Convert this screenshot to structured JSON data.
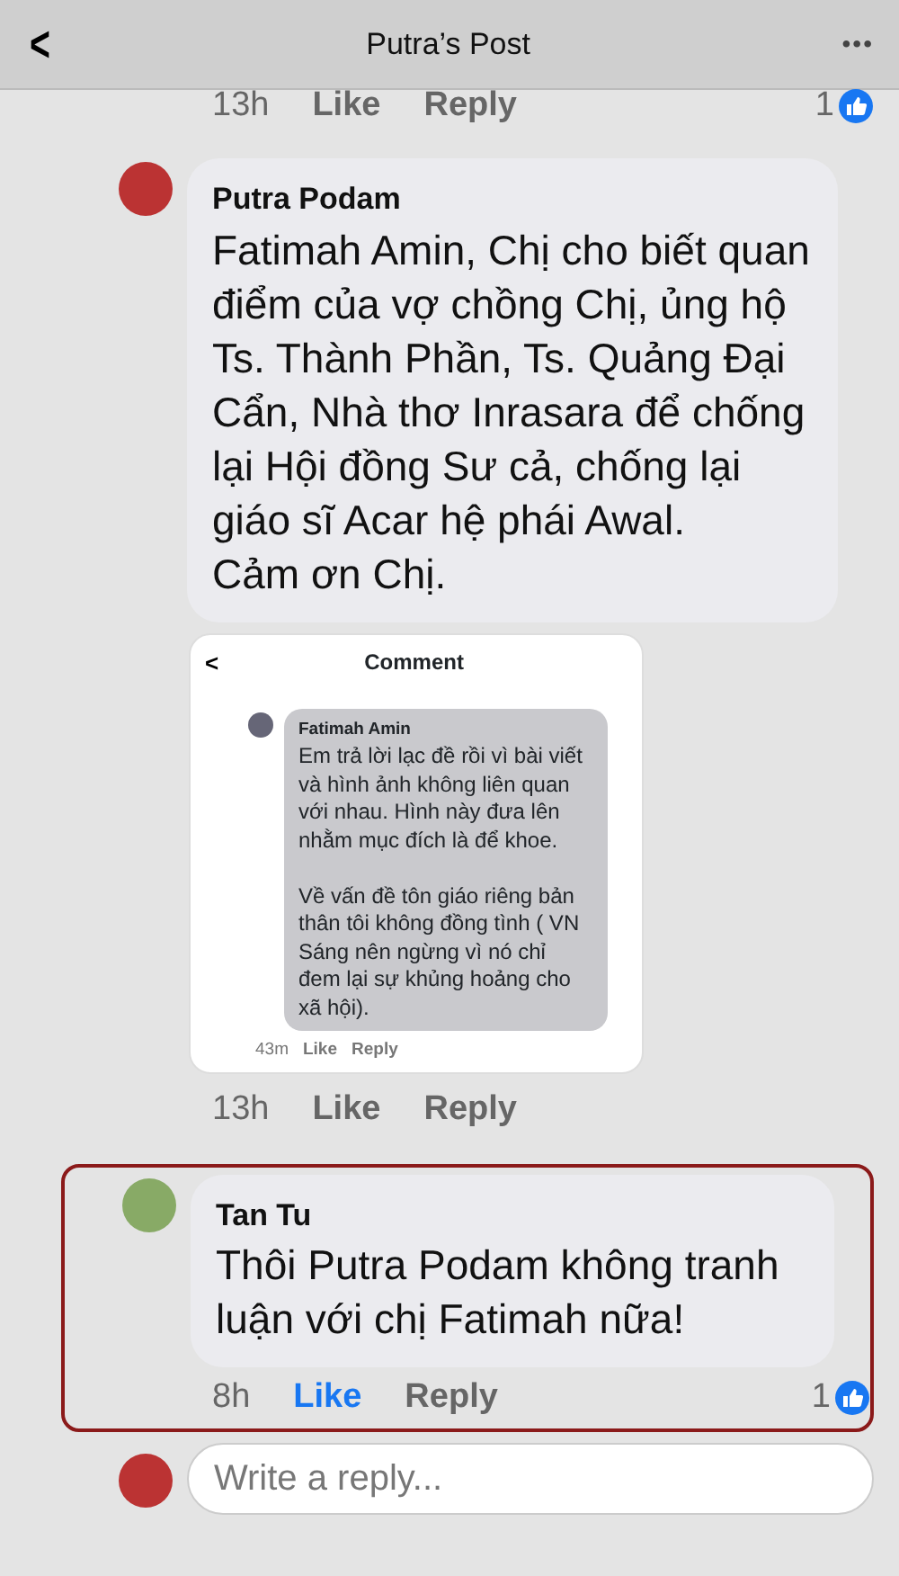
{
  "header": {
    "back": "<",
    "title": "Putra’s Post",
    "more": "•••"
  },
  "comments": [
    {
      "kind": "actions",
      "time": "13h",
      "like": "Like",
      "liked": false,
      "reply": "Reply",
      "reactions": "1",
      "highlighted": false
    },
    {
      "kind": "comment",
      "author": "Putra Podam",
      "text": "Fatimah Amin, Chị cho biết quan điểm của vợ chồng Chị, ủng hộ Ts. Thành Phần, Ts. Quảng Đại Cẩn, Nhà thơ Inrasara  để chống lại Hội đồng Sư cả, chống lại giáo sĩ Acar hệ phái Awal.\nCảm ơn Chị.",
      "attachment": {
        "back": "<",
        "title": "Comment",
        "author": "Fatimah Amin",
        "text": "Em trả lời lạc đề rồi vì bài viết và hình ảnh không liên quan với nhau. Hình này đưa lên nhằm mục đích là để khoe.\n\nVề vấn đề tôn giáo riêng bản thân tôi không đồng tình ( VN Sáng nên ngừng vì nó chỉ đem lại sự khủng hoảng cho xã hội).",
        "time": "43m",
        "like": "Like",
        "reply": "Reply"
      },
      "time": "13h",
      "like": "Like",
      "liked": false,
      "reply": "Reply",
      "highlighted": false
    },
    {
      "kind": "comment",
      "author": "Tan Tu",
      "text": "Thôi Putra Podam không tranh luận với chị Fatimah nữa!",
      "time": "8h",
      "like": "Like",
      "liked": true,
      "reply": "Reply",
      "reactions": "1",
      "highlighted": true
    }
  ],
  "reply_box": {
    "placeholder": "Write a reply..."
  }
}
